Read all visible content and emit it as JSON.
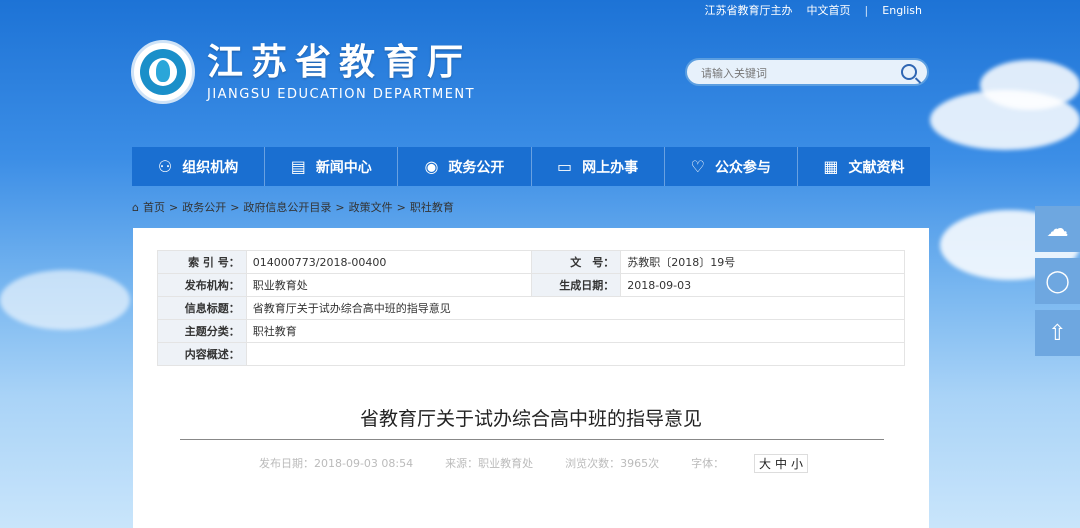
{
  "topbar": {
    "sponsor": "江苏省教育厅主办",
    "lang_cn": "中文首页",
    "separator": "|",
    "lang_en": "English"
  },
  "logo": {
    "cn": "江苏省教育厅",
    "en": "JIANGSU EDUCATION DEPARTMENT"
  },
  "search": {
    "placeholder": "请输入关键词"
  },
  "nav": {
    "items": [
      {
        "label": "组织机构",
        "icon": "org-icon",
        "glyph": "⚇"
      },
      {
        "label": "新闻中心",
        "icon": "news-icon",
        "glyph": "▤"
      },
      {
        "label": "政务公开",
        "icon": "gov-icon",
        "glyph": "◉"
      },
      {
        "label": "网上办事",
        "icon": "online-icon",
        "glyph": "▭"
      },
      {
        "label": "公众参与",
        "icon": "heart-icon",
        "glyph": "♡"
      },
      {
        "label": "文献资料",
        "icon": "archive-icon",
        "glyph": "▦"
      }
    ]
  },
  "breadcrumb": {
    "home": "首页",
    "sep": ">",
    "b1": "政务公开",
    "b2": "政府信息公开目录",
    "b3": "政策文件",
    "b4": "职社教育"
  },
  "meta": {
    "index_key": "索 引 号：",
    "index_val": "014000773/2018-00400",
    "doc_key": "文　号：",
    "doc_val": "苏教职〔2018〕19号",
    "org_key": "发布机构：",
    "org_val": "职业教育处",
    "date_key": "生成日期：",
    "date_val": "2018-09-03",
    "title_key": "信息标题：",
    "title_val": "省教育厅关于试办综合高中班的指导意见",
    "cat_key": "主题分类：",
    "cat_val": "职社教育",
    "summary_key": "内容概述：",
    "summary_val": ""
  },
  "article": {
    "title": "省教育厅关于试办综合高中班的指导意见",
    "pub_date": "发布日期：2018-09-03 08:54",
    "source": "来源：职业教育处",
    "views": "浏览次数：3965次",
    "font_label": "字体：",
    "font_large": "大",
    "font_mid": "中",
    "font_small": "小"
  },
  "side": {
    "weibo_icon": "☁",
    "wechat_icon": "◯",
    "top_icon": "⇧"
  }
}
